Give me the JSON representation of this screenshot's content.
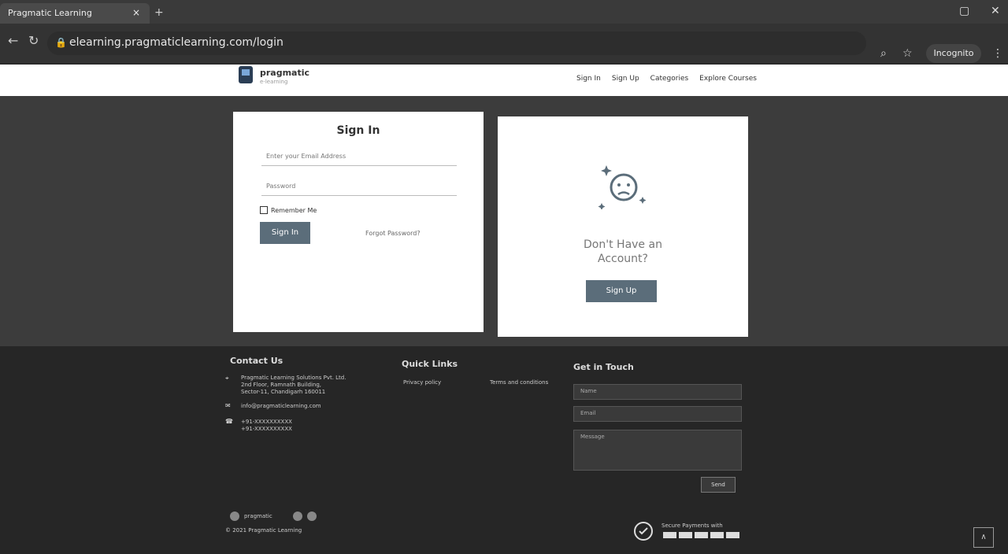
{
  "browser": {
    "tab_title": "Pragmatic Learning",
    "tab_close": "×",
    "new_tab": "+",
    "url": "elearning.pragmaticlearning.com/login",
    "incognito": "Incognito",
    "nav_back": "←",
    "nav_forward": "→",
    "reload": "↻"
  },
  "header": {
    "brand": "pragmatic",
    "brand_sub": "e-learning",
    "nav": [
      "Sign In",
      "Sign Up",
      "Categories",
      "Explore Courses"
    ]
  },
  "signin": {
    "title": "Sign In",
    "email_placeholder": "Enter your Email Address",
    "password_placeholder": "Password",
    "remember": "Remember Me",
    "button": "Sign In",
    "forgot": "Forgot Password?"
  },
  "signup_card": {
    "line1": "Don't Have an",
    "line2": "Account?",
    "button": "Sign Up"
  },
  "footer": {
    "contact_title": "Contact Us",
    "address": [
      "Pragmatic Learning Solutions Pvt. Ltd.",
      "2nd Floor, Ramnath Building,",
      "Sector-11, Chandigarh 160011"
    ],
    "email": "info@pragmaticlearning.com",
    "phones": [
      "+91-XXXXXXXXXX",
      "+91-XXXXXXXXXX"
    ],
    "quick_links_title": "Quick Links",
    "links": [
      "Privacy policy",
      "Terms and conditions"
    ],
    "touch_title": "Get in Touch",
    "name_placeholder": "Name",
    "email_placeholder": "Email",
    "message_placeholder": "Message",
    "send": "Send",
    "copyright": "© 2021 Pragmatic Learning",
    "secure": "Secure Payments with"
  }
}
